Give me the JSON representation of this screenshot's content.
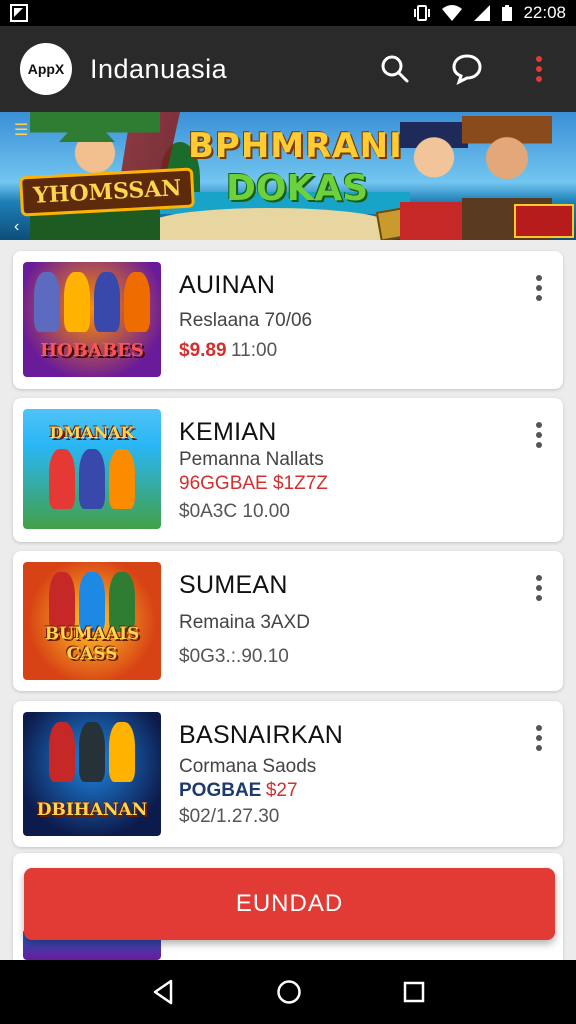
{
  "status_bar": {
    "time": "22:08"
  },
  "app_bar": {
    "logo_text": "AppX",
    "title": "Indanuasia"
  },
  "banner": {
    "left_text": "YHOMSSAN",
    "headline": "BPHMRANI",
    "subheadline": "DOKAS"
  },
  "games": [
    {
      "name": "AUINAN",
      "line1": "Reslaana 70/06",
      "price_red": "$9.89",
      "price_grey": "11:00",
      "thumb_title": "HOBABES"
    },
    {
      "name": "KEMIAN",
      "line1": "Pemanna Nallats",
      "line2": "96GGBAE $1Z7Z",
      "price_grey": "$0A3C 10.00",
      "thumb_title": "DMANAK"
    },
    {
      "name": "SUMEAN",
      "line1": "Remaina 3AXD",
      "price_grey": "$0G3.:.90.10",
      "thumb_title": "BUMAAIS CASS"
    },
    {
      "name": "BASNAIRKAN",
      "line1": "Cormana Saods",
      "price_blue": "POGBAE",
      "price_red": "$27",
      "price_grey": "$02/1.27.30",
      "thumb_title": "DBIHANAN"
    }
  ],
  "cta": {
    "label": "EUNDAD"
  },
  "colors": {
    "accent": "#e23a35",
    "app_bar": "#2a2a2a"
  }
}
